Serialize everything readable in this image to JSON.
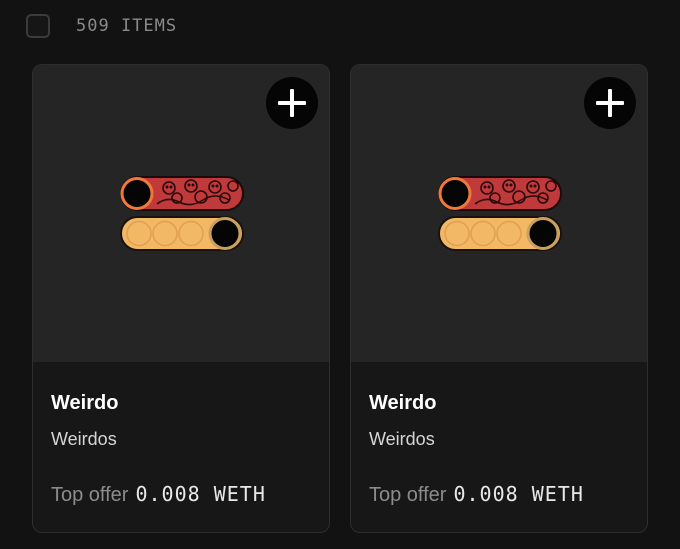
{
  "header": {
    "items_count": "509 ITEMS"
  },
  "cards": [
    {
      "name": "Weirdo",
      "collection": "Weirdos",
      "offer_label": "Top offer",
      "offer_value": "0.008 WETH",
      "add_icon": "plus-icon"
    },
    {
      "name": "Weirdo",
      "collection": "Weirdos",
      "offer_label": "Top offer",
      "offer_value": "0.008 WETH",
      "add_icon": "plus-icon"
    }
  ],
  "colors": {
    "background": "#121212",
    "media_background": "#252525",
    "card_background": "#171717",
    "art_red": "#c0393b",
    "art_yellow": "#f2b866",
    "art_orange_ring": "#f0783a"
  }
}
